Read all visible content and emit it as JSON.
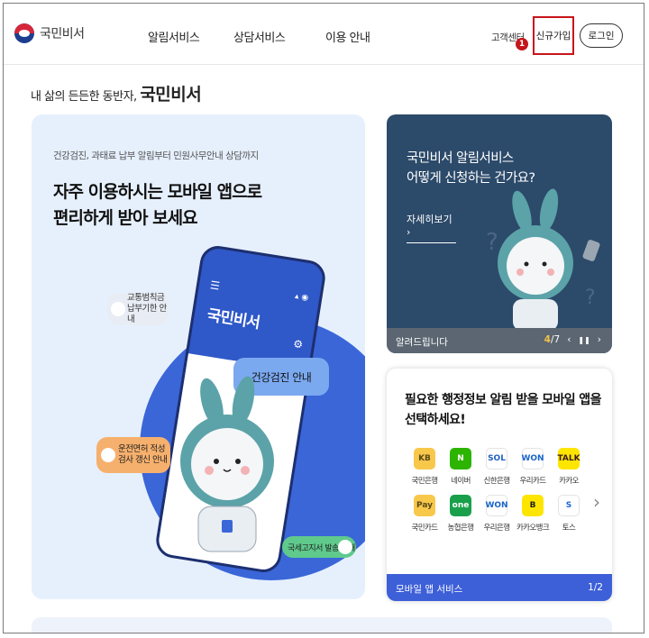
{
  "header": {
    "logo_text": "국민비서",
    "nav": [
      "알림서비스",
      "상담서비스",
      "이용 안내"
    ],
    "customer_center": "고객센터",
    "marker": "1",
    "signup": "신규가입",
    "login": "로그인"
  },
  "tagline": {
    "prefix": "내 삶의 든든한 동반자,",
    "brand": "국민비서"
  },
  "hero": {
    "subtitle": "건강검진, 과태료 납부 알림부터 민원사무안내 상담까지",
    "title_line1": "자주 이용하시는 모바일 앱으로",
    "title_line2": "편리하게 받아 보세요",
    "phone_title": "국민비서",
    "bubble_health": "건강검진 안내",
    "bubble_traffic": "교통범칙금 납부기한 안내",
    "bubble_license": "운전면허 적성검사 갱신 안내",
    "bubble_tax": "국세고지서 발송 안내"
  },
  "promo_card": {
    "title_line1": "국민비서 알림서비스",
    "title_line2": "어떻게 신청하는 건가요?",
    "link": "자세히보기 ›",
    "bar_label": "알려드립니다",
    "page_current": "4",
    "page_total": "/7",
    "prev": "‹",
    "pause": "❚❚",
    "next": "›"
  },
  "apps_card": {
    "title_line1": "필요한 행정정보 알림 받을 모바일 앱을",
    "title_line2": "선택하세요!",
    "apps": [
      {
        "label": "국민은행",
        "icon": "KB",
        "bg": "#f7c84a",
        "fg": "#5a4a1a"
      },
      {
        "label": "네이버",
        "icon": "N",
        "bg": "#2db400",
        "fg": "#ffffff"
      },
      {
        "label": "신한은행",
        "icon": "SOL",
        "bg": "#ffffff",
        "fg": "#1f5fc4"
      },
      {
        "label": "우리카드",
        "icon": "WON",
        "bg": "#ffffff",
        "fg": "#1a64c8"
      },
      {
        "label": "카카오",
        "icon": "TALK",
        "bg": "#fee500",
        "fg": "#3b1e1e"
      },
      {
        "label": "국민카드",
        "icon": "Pay",
        "bg": "#f7c84a",
        "fg": "#5a4a1a"
      },
      {
        "label": "농협은행",
        "icon": "one",
        "bg": "#1aa04a",
        "fg": "#ffffff"
      },
      {
        "label": "우리은행",
        "icon": "WON",
        "bg": "#ffffff",
        "fg": "#1a64c8"
      },
      {
        "label": "카카오뱅크",
        "icon": "B",
        "bg": "#fee500",
        "fg": "#222222"
      },
      {
        "label": "토스",
        "icon": "S",
        "bg": "#ffffff",
        "fg": "#1b64da"
      }
    ],
    "bar_label": "모바일 앱 서비스",
    "bar_page": "1/2"
  }
}
